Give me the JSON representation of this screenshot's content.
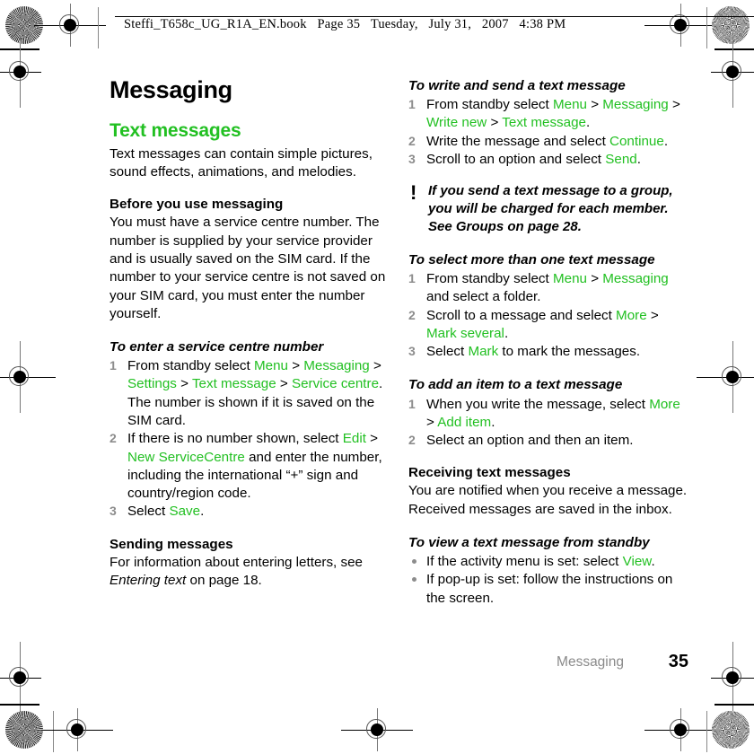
{
  "print_marks": {
    "slug": {
      "filename": "Steffi_T658c_UG_R1A_EN.book",
      "page_label": "Page 35",
      "weekday": "Tuesday,",
      "month_day": "July 31,",
      "year": "2007",
      "time": "4:38 PM"
    }
  },
  "colors": {
    "accent_green": "#22c022",
    "step_number_gray": "#8c8c8c",
    "footer_gray": "#8a8a8a"
  },
  "left_column": {
    "chapter_title": "Messaging",
    "section_title": "Text messages",
    "intro": "Text messages can contain simple pictures, sound effects, animations, and melodies.",
    "before_heading": "Before you use messaging",
    "before_body": "You must have a service centre number. The number is supplied by your service provider and is usually saved on the SIM card. If the number to your service centre is not saved on your SIM card, you must enter the number yourself.",
    "task1_title": "To enter a service centre number",
    "task1_steps": [
      {
        "num": "1",
        "parts": [
          {
            "t": "From standby select ",
            "c": "plain"
          },
          {
            "t": "Menu",
            "c": "ui"
          },
          {
            "t": " > ",
            "c": "plain"
          },
          {
            "t": "Messaging",
            "c": "ui"
          },
          {
            "t": " > ",
            "c": "plain"
          },
          {
            "t": "Settings",
            "c": "ui"
          },
          {
            "t": " > ",
            "c": "plain"
          },
          {
            "t": "Text message",
            "c": "ui"
          },
          {
            "t": " > ",
            "c": "plain"
          },
          {
            "t": "Service centre",
            "c": "ui"
          },
          {
            "t": ". The number is shown if it is saved on the SIM card.",
            "c": "plain"
          }
        ]
      },
      {
        "num": "2",
        "parts": [
          {
            "t": "If there is no number shown, select ",
            "c": "plain"
          },
          {
            "t": "Edit",
            "c": "ui"
          },
          {
            "t": " > ",
            "c": "plain"
          },
          {
            "t": "New ServiceCentre",
            "c": "ui"
          },
          {
            "t": " and enter the number, including the international “+” sign and country/region code.",
            "c": "plain"
          }
        ]
      },
      {
        "num": "3",
        "parts": [
          {
            "t": "Select ",
            "c": "plain"
          },
          {
            "t": "Save",
            "c": "ui"
          },
          {
            "t": ".",
            "c": "plain"
          }
        ]
      }
    ],
    "sending_heading": "Sending messages",
    "sending_body_1": "For information about entering letters, see ",
    "sending_body_italic": "Entering text",
    "sending_body_2": " on page 18."
  },
  "right_column": {
    "task_write_title": "To write and send a text message",
    "task_write_steps": [
      {
        "num": "1",
        "parts": [
          {
            "t": "From standby select ",
            "c": "plain"
          },
          {
            "t": "Menu",
            "c": "ui"
          },
          {
            "t": " > ",
            "c": "plain"
          },
          {
            "t": "Messaging",
            "c": "ui"
          },
          {
            "t": " > ",
            "c": "plain"
          },
          {
            "t": "Write new",
            "c": "ui"
          },
          {
            "t": " > ",
            "c": "plain"
          },
          {
            "t": "Text message",
            "c": "ui"
          },
          {
            "t": ".",
            "c": "plain"
          }
        ]
      },
      {
        "num": "2",
        "parts": [
          {
            "t": "Write the message and select ",
            "c": "plain"
          },
          {
            "t": "Continue",
            "c": "ui"
          },
          {
            "t": ".",
            "c": "plain"
          }
        ]
      },
      {
        "num": "3",
        "parts": [
          {
            "t": "Scroll to an option and select ",
            "c": "plain"
          },
          {
            "t": "Send",
            "c": "ui"
          },
          {
            "t": ".",
            "c": "plain"
          }
        ]
      }
    ],
    "note": {
      "icon": "exclamation-note-icon",
      "text": "If you send a text message to a group, you will be charged for each member. See Groups on page 28."
    },
    "task_select_title": "To select more than one text message",
    "task_select_steps": [
      {
        "num": "1",
        "parts": [
          {
            "t": "From standby select ",
            "c": "plain"
          },
          {
            "t": "Menu",
            "c": "ui"
          },
          {
            "t": " > ",
            "c": "plain"
          },
          {
            "t": "Messaging",
            "c": "ui"
          },
          {
            "t": " and select a folder.",
            "c": "plain"
          }
        ]
      },
      {
        "num": "2",
        "parts": [
          {
            "t": "Scroll to a message and select ",
            "c": "plain"
          },
          {
            "t": "More",
            "c": "ui"
          },
          {
            "t": " > ",
            "c": "plain"
          },
          {
            "t": "Mark several",
            "c": "ui"
          },
          {
            "t": ".",
            "c": "plain"
          }
        ]
      },
      {
        "num": "3",
        "parts": [
          {
            "t": "Select ",
            "c": "plain"
          },
          {
            "t": "Mark",
            "c": "ui"
          },
          {
            "t": " to mark the messages.",
            "c": "plain"
          }
        ]
      }
    ],
    "task_add_title": "To add an item to a text message",
    "task_add_steps": [
      {
        "num": "1",
        "parts": [
          {
            "t": "When you write the message, select ",
            "c": "plain"
          },
          {
            "t": "More",
            "c": "ui"
          },
          {
            "t": " > ",
            "c": "plain"
          },
          {
            "t": "Add item",
            "c": "ui"
          },
          {
            "t": ".",
            "c": "plain"
          }
        ]
      },
      {
        "num": "2",
        "parts": [
          {
            "t": "Select an option and then an item.",
            "c": "plain"
          }
        ]
      }
    ],
    "receiving_heading": "Receiving text messages",
    "receiving_body": "You are notified when you receive a message. Received messages are saved in the inbox.",
    "task_view_title": "To view a text message from standby",
    "task_view_bullets": [
      {
        "parts": [
          {
            "t": "If the activity menu is set: select ",
            "c": "plain"
          },
          {
            "t": "View",
            "c": "ui"
          },
          {
            "t": ".",
            "c": "plain"
          }
        ]
      },
      {
        "parts": [
          {
            "t": "If pop-up is set: follow the instructions on the screen.",
            "c": "plain"
          }
        ]
      }
    ]
  },
  "footer": {
    "chapter": "Messaging",
    "page_number": "35"
  }
}
